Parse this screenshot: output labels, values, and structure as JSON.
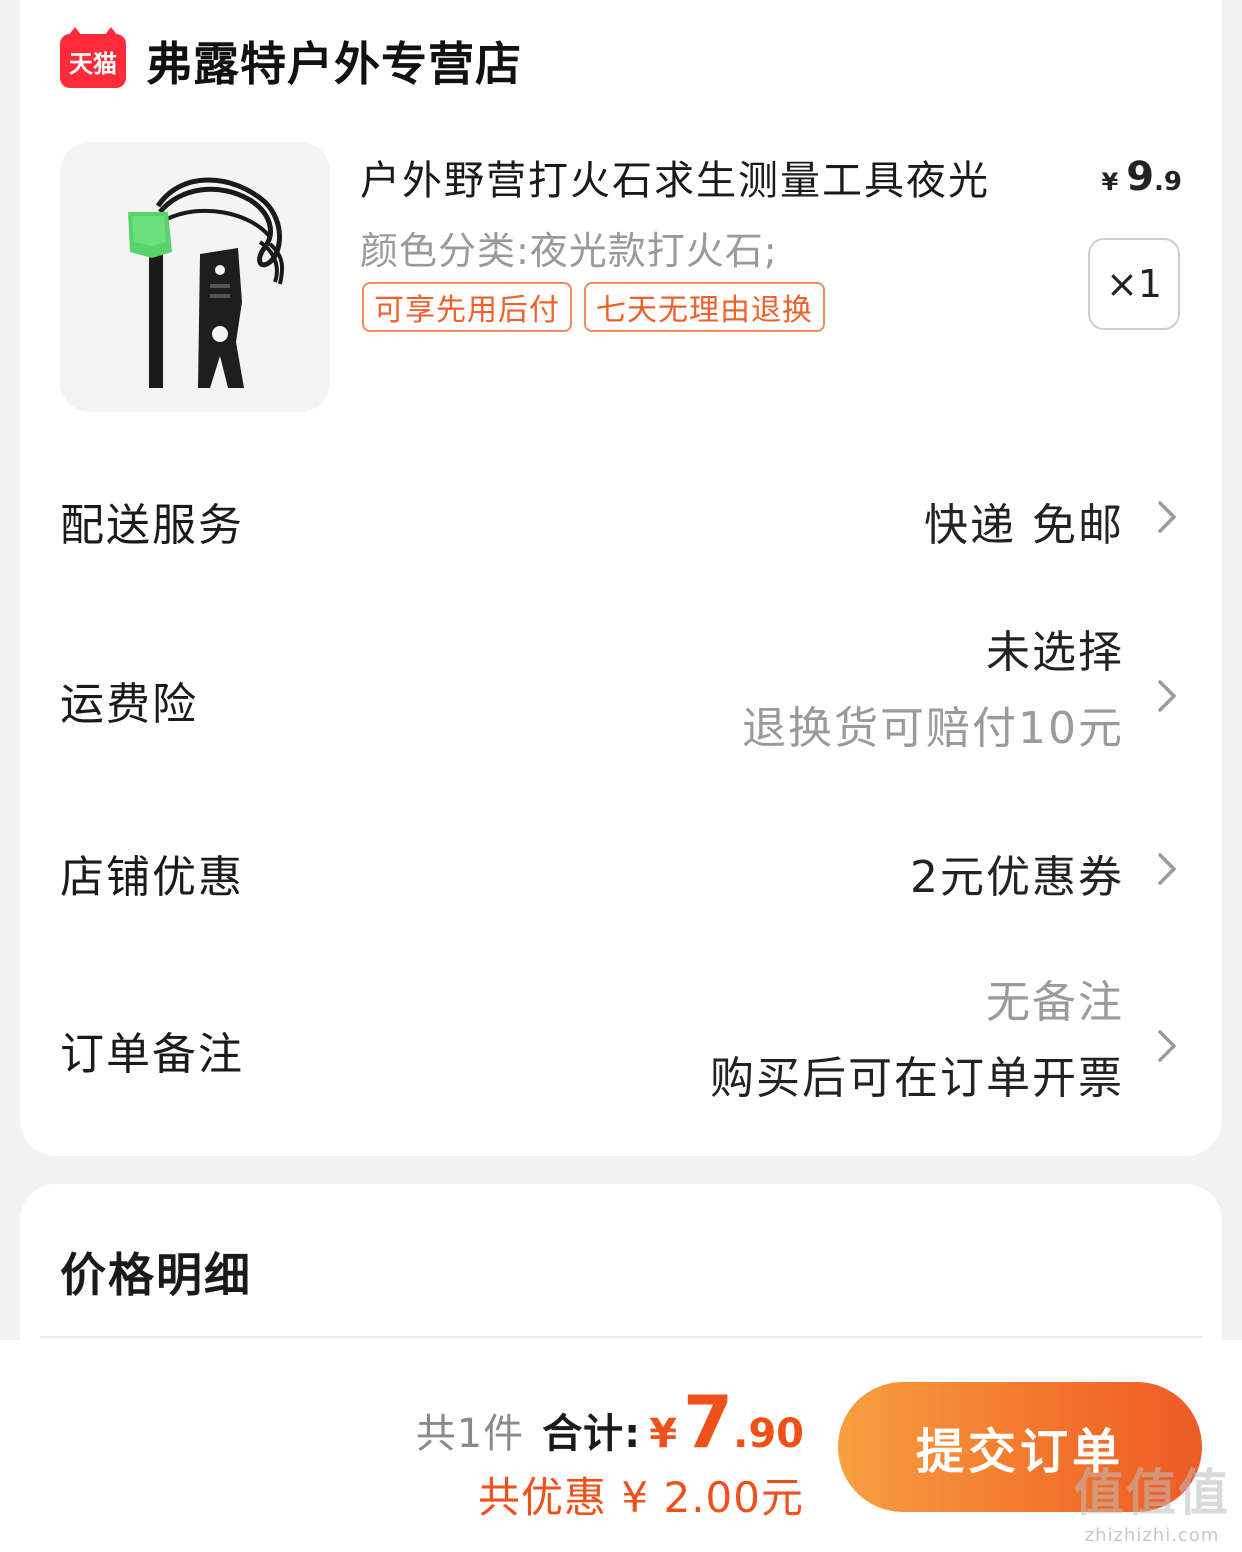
{
  "store": {
    "badge": "天猫",
    "name": "弗露特户外专营店"
  },
  "product": {
    "title": "户外野营打火石求生测量工具夜光",
    "spec": "颜色分类:夜光款打火石;",
    "tags": [
      "可享先用后付",
      "七天无理由退换"
    ],
    "price": {
      "currency": "¥",
      "integer": "9",
      "decimal": ".9"
    },
    "quantity": "×1"
  },
  "rows": {
    "delivery": {
      "label": "配送服务",
      "value": "快递 免邮"
    },
    "insurance": {
      "label": "运费险",
      "value": "未选择",
      "sub": "退换货可赔付10元"
    },
    "coupon": {
      "label": "店铺优惠",
      "value": "2元优惠券"
    },
    "remark": {
      "label": "订单备注",
      "value": "无备注",
      "sub": "购买后可在订单开票"
    }
  },
  "price_detail": {
    "title": "价格明细"
  },
  "summary": {
    "count": "共1件",
    "total_label": "合计:",
    "currency": "¥",
    "total_integer": "7",
    "total_decimal": ".90",
    "discount": "共优惠 ¥ 2.00元",
    "submit": "提交订单"
  },
  "watermark": {
    "big": "值值值",
    "small": "zhizhizhi.com"
  },
  "colors": {
    "accent": "#f0511a",
    "tmall": "#ff2b3a",
    "tag_border": "#f08a5e"
  }
}
